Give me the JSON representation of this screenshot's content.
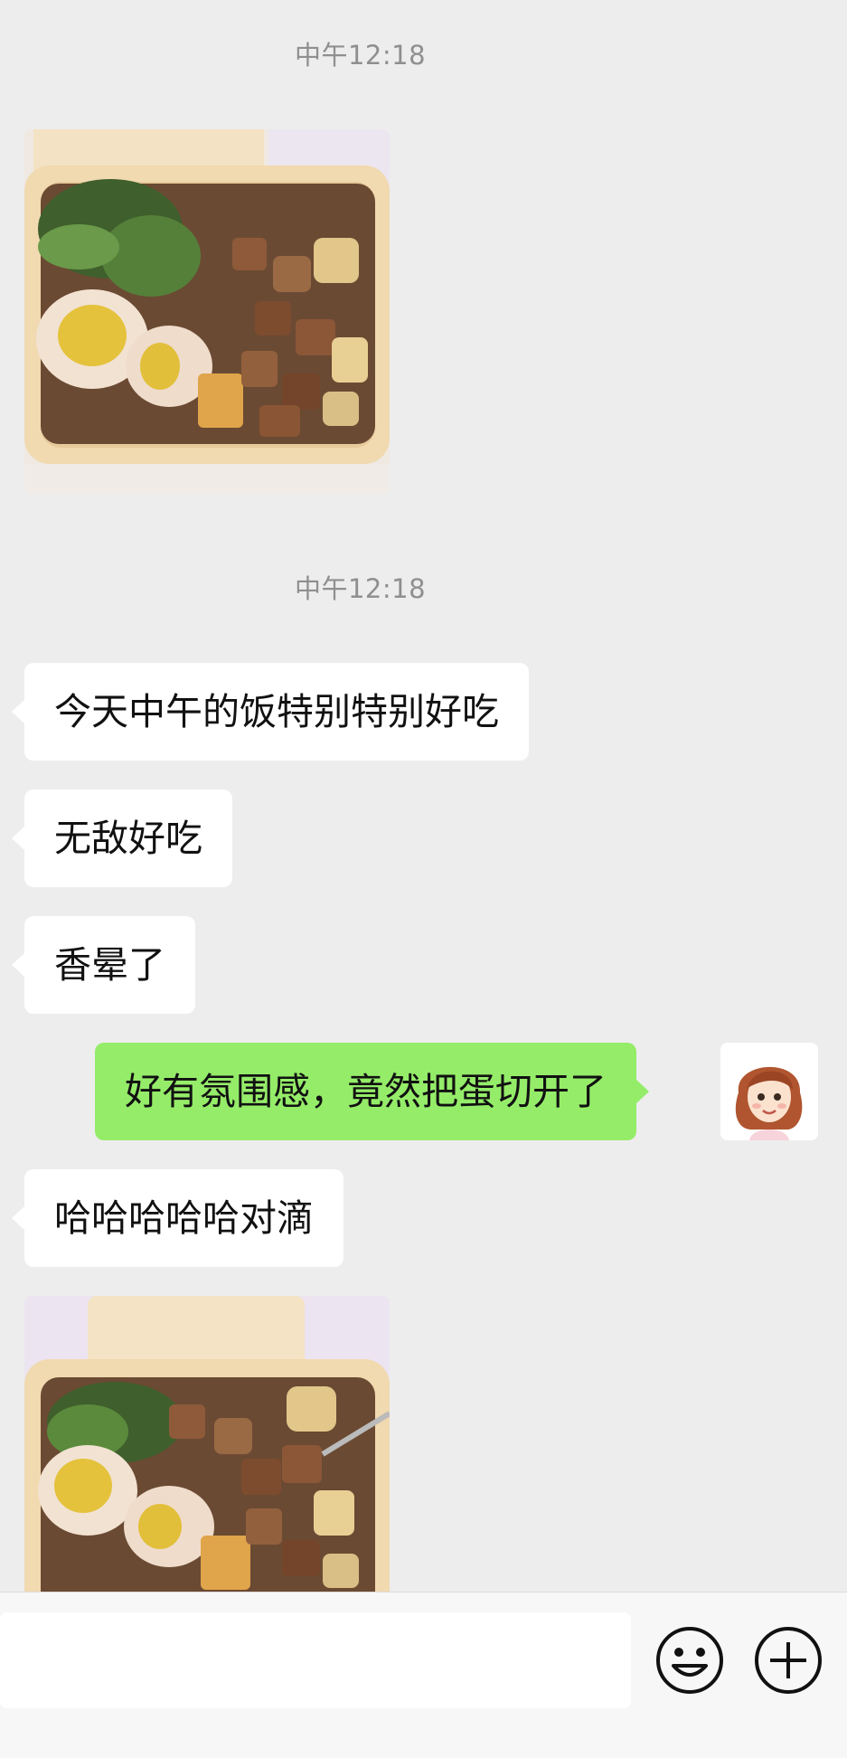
{
  "chat": {
    "timestamps": [
      "中午12:18",
      "中午12:18"
    ],
    "messages": {
      "m1": "今天中午的饭特别特别好吃",
      "m2": "无敌好吃",
      "m3": "香晕了",
      "m4": "好有氛围感，竟然把蛋切开了",
      "m5": "哈哈哈哈哈对滴"
    }
  },
  "photos": {
    "photo1": "bento-box-photo",
    "photo2": "bento-box-photo"
  },
  "input_bar": {
    "text": "",
    "emoji_icon": "smiley-face-icon",
    "plus_icon": "plus-circle-icon"
  },
  "colors": {
    "background": "#ededed",
    "incoming_bubble": "#ffffff",
    "outgoing_bubble": "#95ec69",
    "timestamp": "#8f8f8f"
  }
}
